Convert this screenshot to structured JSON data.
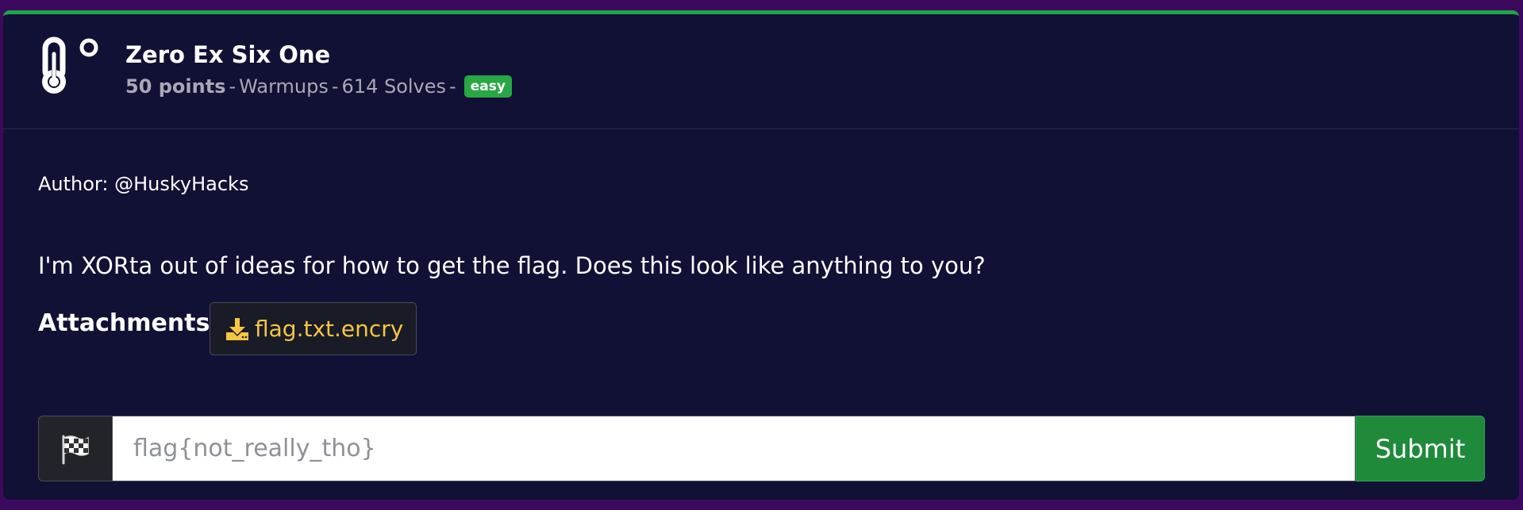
{
  "challenge": {
    "title": "Zero Ex Six One",
    "points": "50 points",
    "category": "Warmups",
    "solves": "614 Solves",
    "difficulty": "easy",
    "separator": "-",
    "icon": "thermometer-icon"
  },
  "body": {
    "author": "Author: @HuskyHacks",
    "description": "I'm XORta out of ideas for how to get the flag. Does this look like anything to you?",
    "attachments_label": "Attachments:",
    "attachments": [
      {
        "name": "flag.txt.encry",
        "icon": "download-icon"
      }
    ]
  },
  "flag_form": {
    "prefix_icon": "checkered-flag-icon",
    "placeholder": "flag{not_really_tho}",
    "value": "",
    "submit_label": "Submit"
  },
  "colors": {
    "page_bg": "#3b0a5f",
    "card_bg": "#111035",
    "accent_top": "#1fa447",
    "badge_bg": "#28a745",
    "attachment_text": "#f7c544",
    "submit_bg": "#1e8a3a"
  }
}
